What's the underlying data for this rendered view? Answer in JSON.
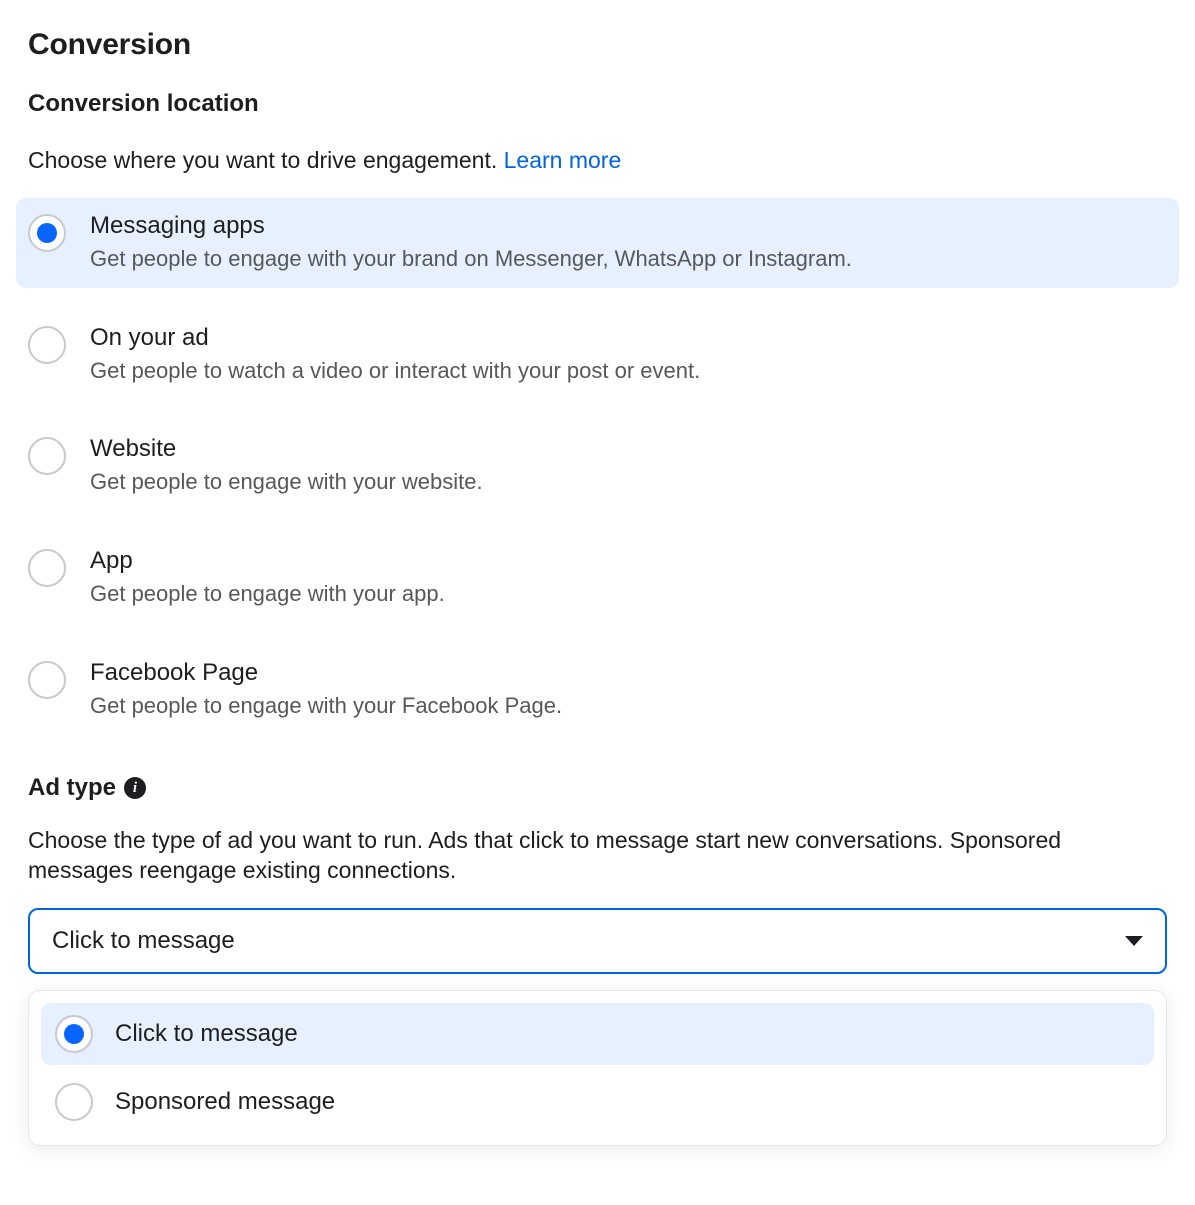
{
  "conversion": {
    "title": "Conversion",
    "location": {
      "title": "Conversion location",
      "prompt": "Choose where you want to drive engagement. ",
      "learn_more": "Learn more",
      "selected_index": 0,
      "options": [
        {
          "title": "Messaging apps",
          "desc": "Get people to engage with your brand on Messenger, WhatsApp or Instagram."
        },
        {
          "title": "On your ad",
          "desc": "Get people to watch a video or interact with your post or event."
        },
        {
          "title": "Website",
          "desc": "Get people to engage with your website."
        },
        {
          "title": "App",
          "desc": "Get people to engage with your app."
        },
        {
          "title": "Facebook Page",
          "desc": "Get people to engage with your Facebook Page."
        }
      ]
    },
    "ad_type": {
      "title": "Ad type",
      "prompt": "Choose the type of ad you want to run. Ads that click to message start new conversations. Sponsored messages reengage existing connections.",
      "selected_value": "Click to message",
      "options": [
        {
          "label": "Click to message",
          "selected": true
        },
        {
          "label": "Sponsored message",
          "selected": false
        }
      ]
    }
  }
}
